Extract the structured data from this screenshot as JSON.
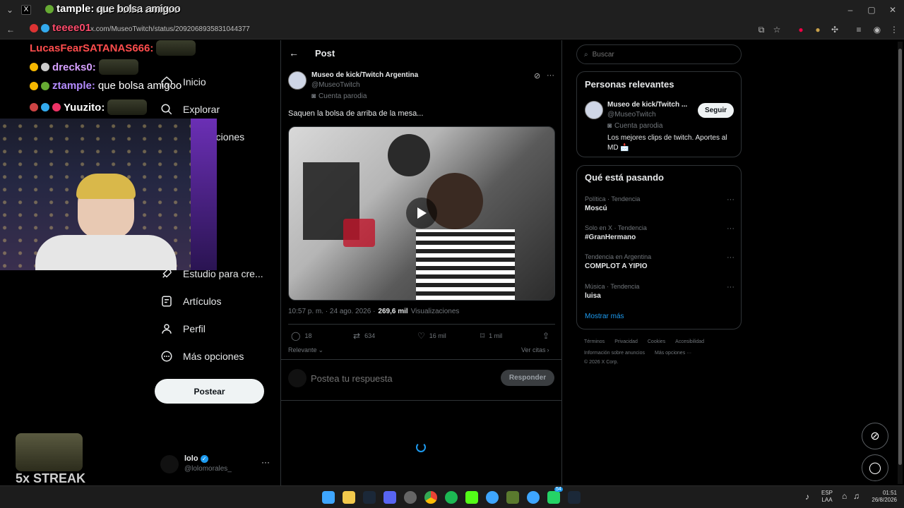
{
  "browser": {
    "tab_title": "que bolsa amigoo",
    "url": "x.com/MuseoTwitch/status/2092068935831044377",
    "window_controls": [
      "minimize-icon",
      "maximize-icon",
      "close-icon"
    ]
  },
  "stream_overlay": {
    "chat": [
      {
        "user": "tample:",
        "message": "que bolsa amigoo",
        "color": "#ffffff"
      },
      {
        "user": "teeee01",
        "message": "",
        "color": "#ff4d6d"
      },
      {
        "user": "LucasFearSATANAS666:",
        "message": "",
        "color": "#ff4d4d"
      },
      {
        "user": "drecks0:",
        "message": "",
        "color": "#d6a0ff"
      },
      {
        "user": "ztample:",
        "message": "que bolsa amigoo",
        "color": "#b48cff"
      },
      {
        "user": "Yuuzito:",
        "message": "",
        "color": "#ffffff"
      }
    ],
    "streak": "5x STREAK"
  },
  "nav": {
    "items": [
      {
        "label": "Inicio",
        "icon": "home-icon"
      },
      {
        "label": "Explorar",
        "icon": "search-icon"
      },
      {
        "label": "Notificaciones",
        "icon": "bell-icon"
      },
      {
        "label": "Estudio para cre...",
        "icon": "rocket-icon"
      },
      {
        "label": "Artículos",
        "icon": "article-icon"
      },
      {
        "label": "Perfil",
        "icon": "person-icon"
      },
      {
        "label": "Más opciones",
        "icon": "more-circle-icon"
      }
    ],
    "post_button": "Postear",
    "account": {
      "name": "lolo",
      "handle": "@lolomorales_"
    }
  },
  "post": {
    "header": "Post",
    "author_name": "Museo de kick/Twitch Argentina",
    "author_handle": "@MuseoTwitch",
    "parody_label": "Cuenta parodia",
    "text": "Saquen la bolsa de arriba de la mesa...",
    "timestamp": "10:57 p. m. · 24 ago. 2026 ·",
    "views_count": "269,6 mil",
    "views_label": "Visualizaciones",
    "actions": {
      "replies": "18",
      "reposts": "634",
      "likes": "16 mil",
      "bookmarks": "1 mil"
    },
    "sort_label": "Relevante",
    "quotes_link": "Ver citas",
    "reply_placeholder": "Postea tu respuesta",
    "reply_button": "Responder"
  },
  "sidebar": {
    "search_placeholder": "Buscar",
    "relevant_title": "Personas relevantes",
    "relevant_person": {
      "name": "Museo de kick/Twitch ...",
      "handle": "@MuseoTwitch",
      "parody_label": "Cuenta parodia",
      "bio": "Los mejores clips de twitch. Aportes al MD 📩",
      "follow_label": "Seguir"
    },
    "trends_title": "Qué está pasando",
    "trends": [
      {
        "category": "Política · Tendencia",
        "name": "Moscú"
      },
      {
        "category": "Solo en X · Tendencia",
        "name": "#GranHermano"
      },
      {
        "category": "Tendencia en Argentina",
        "name": "COMPLOT A YIPIO"
      },
      {
        "category": "Música · Tendencia",
        "name": "luisa"
      }
    ],
    "show_more": "Mostrar más",
    "footer_line1": [
      "Términos",
      "Privacidad",
      "Cookies",
      "Accesibilidad"
    ],
    "footer_line2": [
      "Información sobre anuncios",
      "Más opciones ···"
    ],
    "copyright": "© 2026 X Corp."
  },
  "taskbar": {
    "lang": "ESP",
    "lang2": "LAA",
    "time": "01:51",
    "date": "26/8/2026",
    "badge": "54"
  },
  "colors": {
    "accent": "#1d9bf0",
    "bg": "#000000",
    "border": "#2f3336"
  }
}
